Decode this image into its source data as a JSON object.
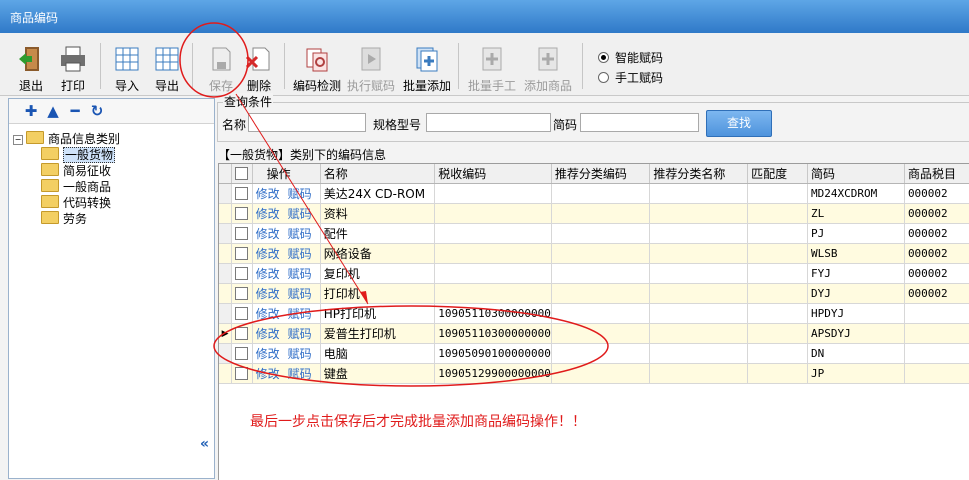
{
  "window": {
    "title": "商品编码"
  },
  "toolbar": {
    "exit": "退出",
    "print": "打印",
    "import": "导入",
    "export": "导出",
    "save": "保存",
    "delete": "删除",
    "code_check": "编码检测",
    "exec_code": "执行赋码",
    "batch_add": "批量添加",
    "batch_manual": "批量手工",
    "add_goods": "添加商品",
    "smart_code": "智能赋码",
    "manual_code": "手工赋码"
  },
  "tree": {
    "root": "商品信息类别",
    "items": [
      "一般货物",
      "简易征收",
      "一般商品",
      "代码转换",
      "劳务"
    ]
  },
  "query": {
    "title": "查询条件",
    "name_label": "名称",
    "spec_label": "规格型号",
    "abbr_label": "简码",
    "find_button": "查找"
  },
  "grid": {
    "title": "【一般货物】类别下的编码信息",
    "columns": [
      "操作",
      "名称",
      "税收编码",
      "推荐分类编码",
      "推荐分类名称",
      "匹配度",
      "简码",
      "商品税目"
    ],
    "action_edit": "修改",
    "action_code": "赋码",
    "rows": [
      {
        "name": "美达24X CD-ROM",
        "tax_code": "",
        "abbr": "MD24XCDROM",
        "item": "000002"
      },
      {
        "name": "资料",
        "tax_code": "",
        "abbr": "ZL",
        "item": "000002"
      },
      {
        "name": "配件",
        "tax_code": "",
        "abbr": "PJ",
        "item": "000002"
      },
      {
        "name": "网络设备",
        "tax_code": "",
        "abbr": "WLSB",
        "item": "000002"
      },
      {
        "name": "复印机",
        "tax_code": "",
        "abbr": "FYJ",
        "item": "000002"
      },
      {
        "name": "打印机",
        "tax_code": "",
        "abbr": "DYJ",
        "item": "000002"
      },
      {
        "name": "HP打印机",
        "tax_code": "10905110300000000",
        "abbr": "HPDYJ",
        "item": ""
      },
      {
        "name": "爱普生打印机",
        "tax_code": "10905110300000000",
        "abbr": "APSDYJ",
        "item": ""
      },
      {
        "name": "电脑",
        "tax_code": "10905090100000000",
        "abbr": "DN",
        "item": ""
      },
      {
        "name": "键盘",
        "tax_code": "10905129900000000",
        "abbr": "JP",
        "item": ""
      }
    ]
  },
  "annotation": {
    "text": "最后一步点击保存后才完成批量添加商品编码操作！！",
    "color": "#e01b1b"
  }
}
